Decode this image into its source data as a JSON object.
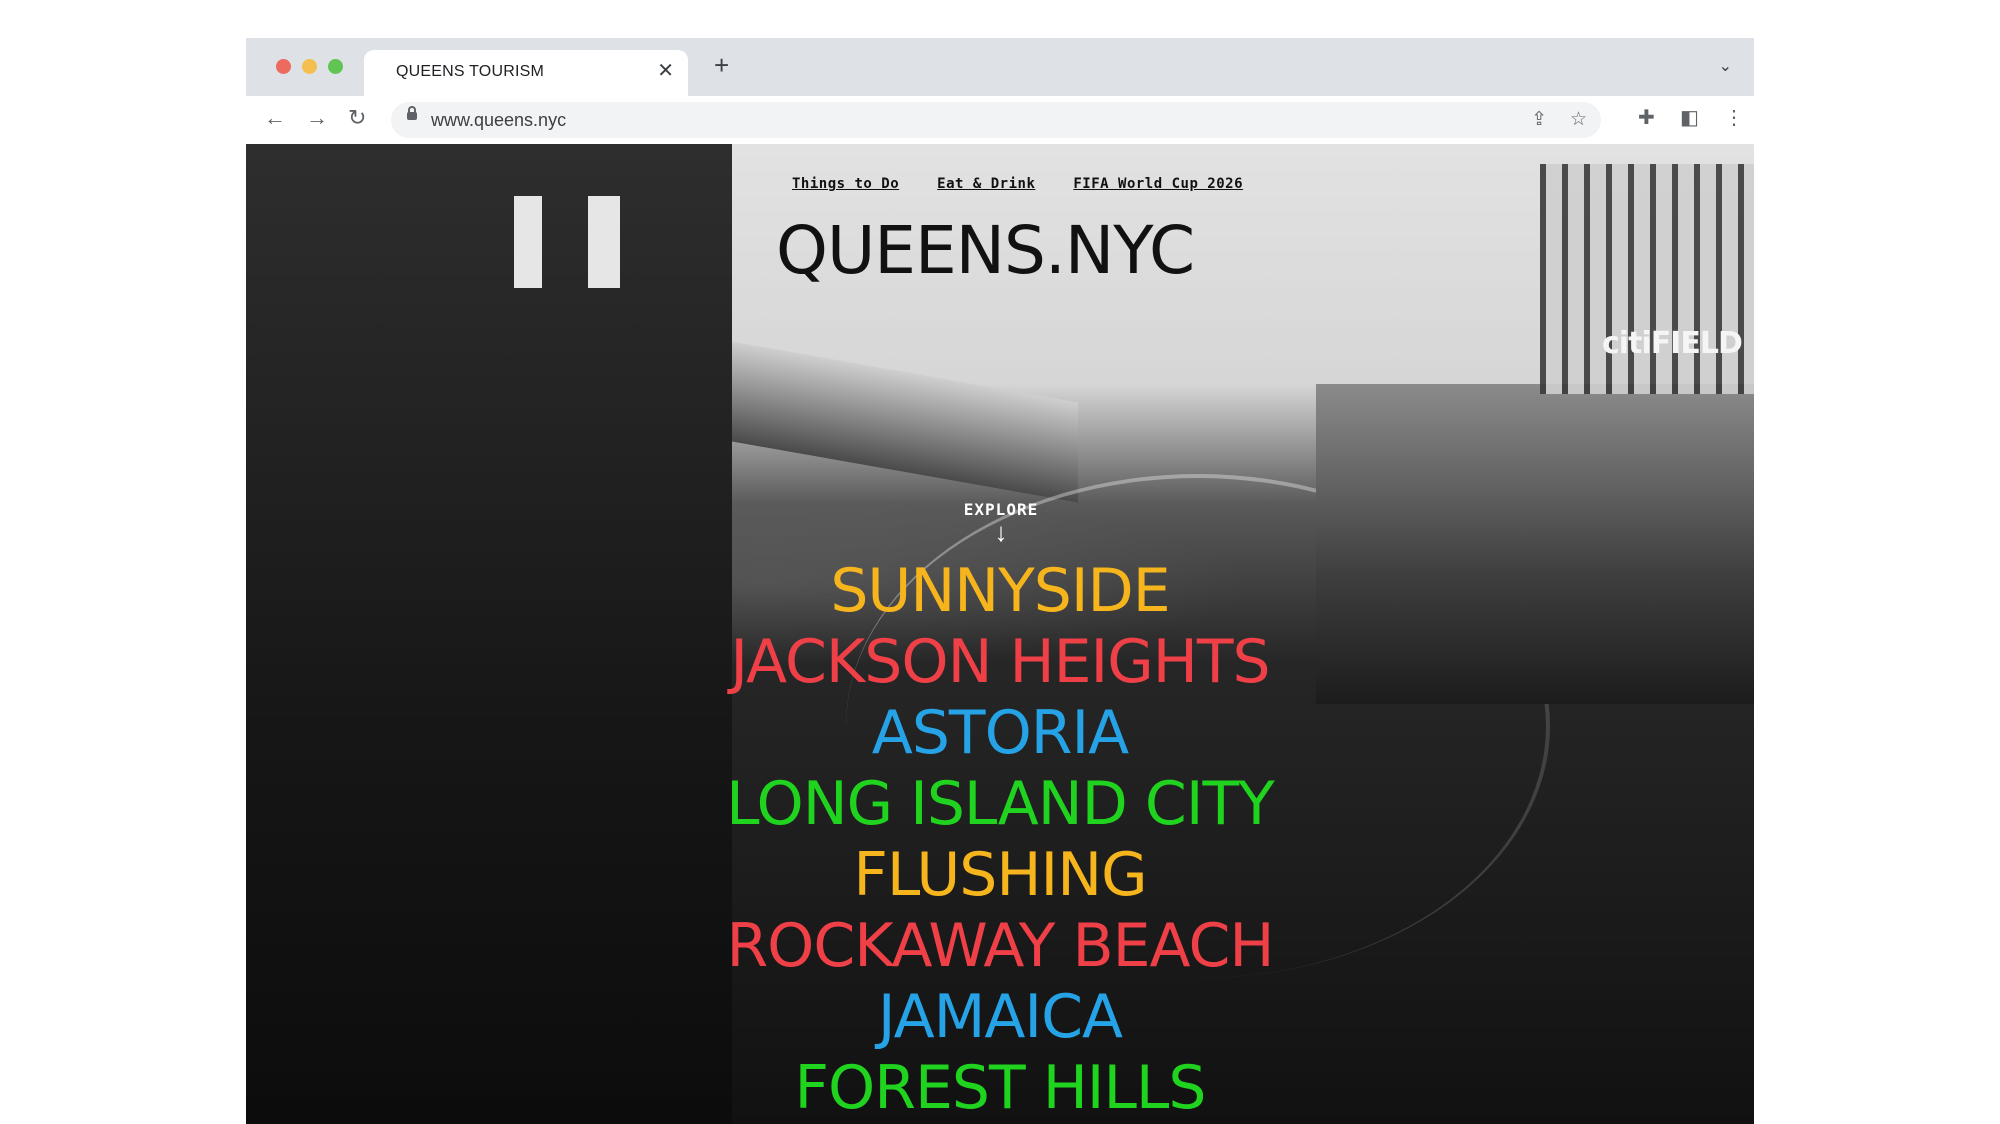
{
  "browser": {
    "tab_title": "QUEENS TOURISM",
    "tab_close_icon": "close-icon",
    "new_tab_icon": "plus-icon",
    "tab_menu_icon": "chevron-down-icon",
    "url": "www.queens.nyc",
    "icons": [
      "back-arrow-icon",
      "forward-arrow-icon",
      "reload-icon",
      "lock-icon",
      "share-icon",
      "star-icon",
      "extensions-icon",
      "side-panel-icon",
      "more-vert-icon"
    ]
  },
  "site": {
    "nav": [
      "Things to Do",
      "Eat & Drink",
      "FIFA World Cup 2026"
    ],
    "logo": "QUEENS.NYC",
    "background_sign": "citiFIELD",
    "explore": {
      "label": "EXPLORE",
      "icon": "down-arrow-icon"
    },
    "neighborhoods": [
      {
        "name": "SUNNYSIDE",
        "color": "#f7b51d"
      },
      {
        "name": "JACKSON HEIGHTS",
        "color": "#ef4048"
      },
      {
        "name": "ASTORIA",
        "color": "#25a3e6"
      },
      {
        "name": "LONG ISLAND CITY",
        "color": "#1fd31f"
      },
      {
        "name": "FLUSHING",
        "color": "#f7b51d"
      },
      {
        "name": "ROCKAWAY BEACH",
        "color": "#ef4048"
      },
      {
        "name": "JAMAICA",
        "color": "#25a3e6"
      },
      {
        "name": "FOREST HILLS",
        "color": "#1fd31f"
      }
    ]
  }
}
